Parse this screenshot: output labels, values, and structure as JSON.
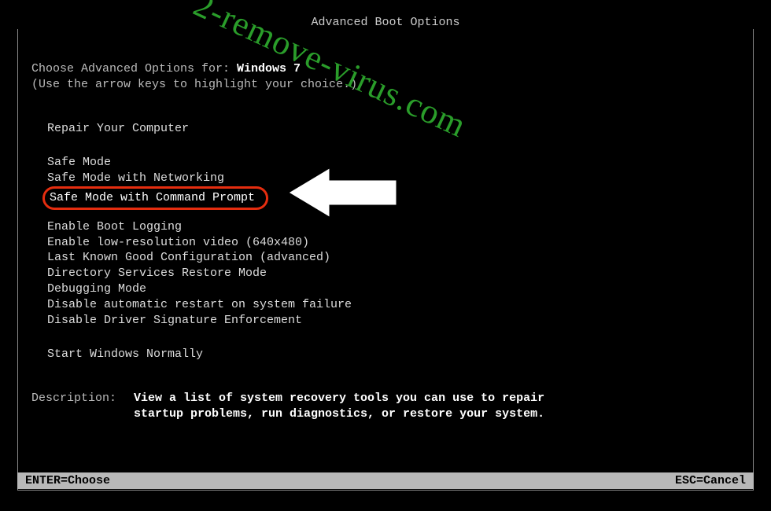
{
  "title": "Advanced Boot Options",
  "intro": {
    "line1_label": "Choose Advanced Options for: ",
    "line1_value": "Windows 7",
    "line2": "(Use the arrow keys to highlight your choice.)"
  },
  "options": {
    "repair": "Repair Your Computer",
    "safe": "Safe Mode",
    "safe_net": "Safe Mode with Networking",
    "safe_cmd": "Safe Mode with Command Prompt",
    "boot_log": "Enable Boot Logging",
    "lowres": "Enable low-resolution video (640x480)",
    "lkgc": "Last Known Good Configuration (advanced)",
    "dsrm": "Directory Services Restore Mode",
    "debug": "Debugging Mode",
    "no_restart": "Disable automatic restart on system failure",
    "no_sig": "Disable Driver Signature Enforcement",
    "start_normal": "Start Windows Normally"
  },
  "description": {
    "label": "Description:",
    "text": "View a list of system recovery tools you can use to repair startup problems, run diagnostics, or restore your system."
  },
  "footer": {
    "enter": "ENTER=Choose",
    "esc": "ESC=Cancel"
  },
  "watermark": "2-remove-virus.com",
  "highlight_color": "#e52d0f",
  "watermark_color": "#2a9d2a"
}
